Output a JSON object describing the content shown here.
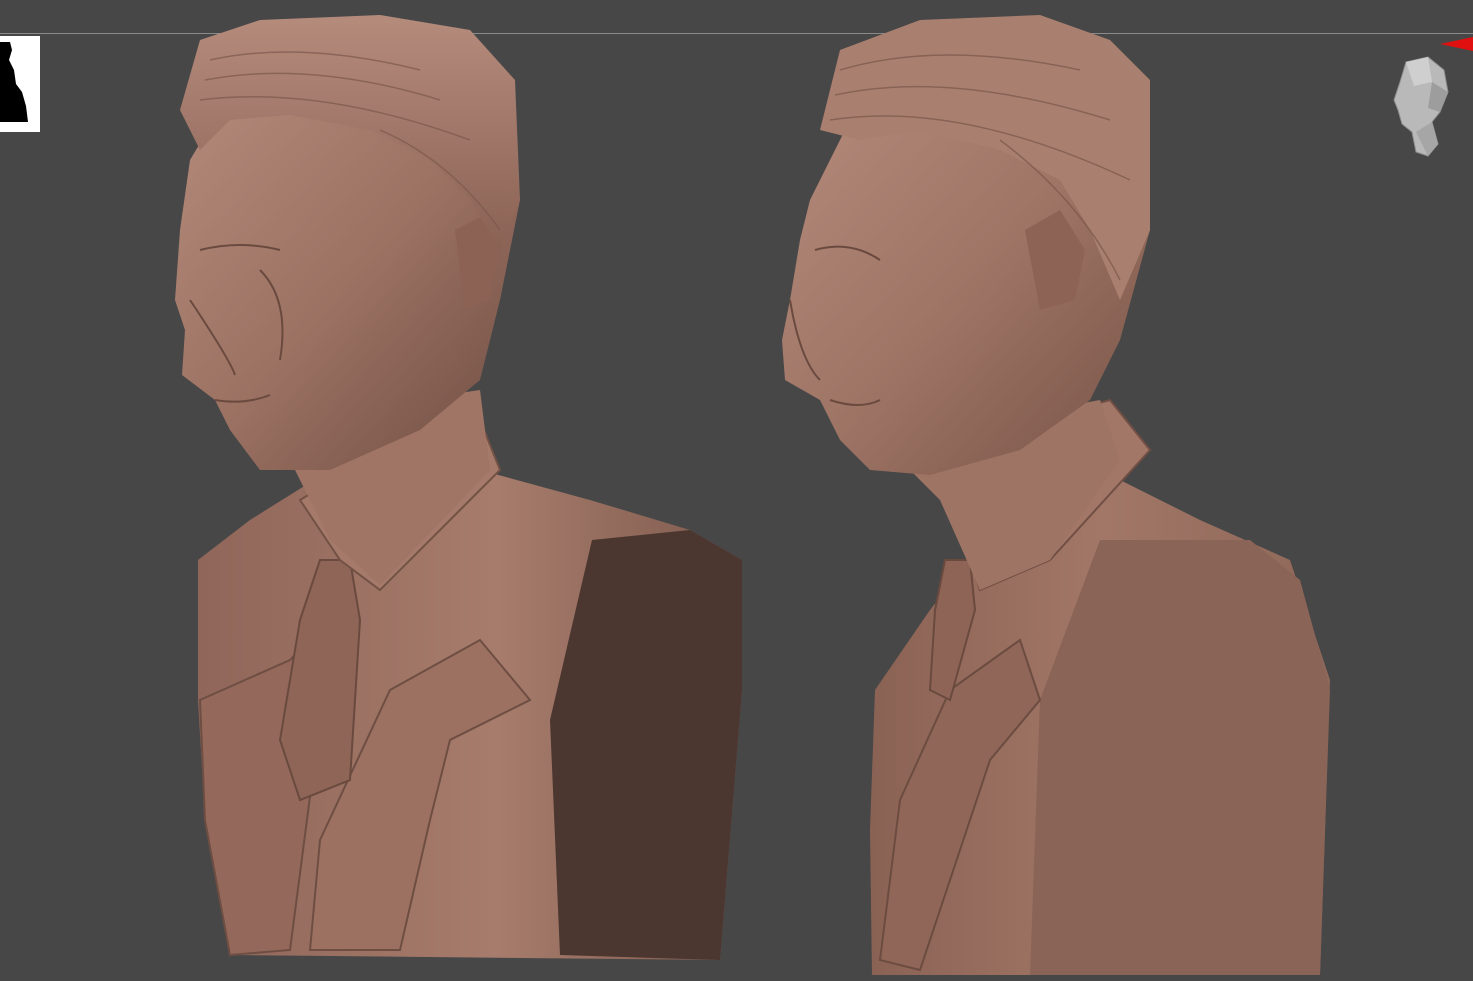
{
  "viewport": {
    "background": "#474747",
    "sculpt_material_light": "#a47a6b",
    "sculpt_material_mid": "#8d6557",
    "sculpt_material_shadow": "#5e4138",
    "axis_color": "#e01010"
  },
  "thumbnail": {
    "icon": "silhouette-thumbnail-icon"
  },
  "models": [
    {
      "icon": "bust-three-quarter-view"
    },
    {
      "icon": "bust-side-view"
    }
  ],
  "navigation": {
    "icon": "navigation-head-icon"
  }
}
